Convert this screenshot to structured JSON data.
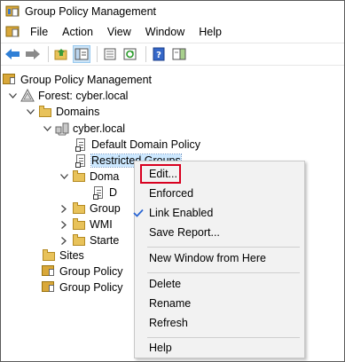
{
  "window": {
    "title": "Group Policy Management"
  },
  "menu": {
    "items": [
      "File",
      "Action",
      "View",
      "Window",
      "Help"
    ]
  },
  "toolbar": {
    "buttons": [
      "back-icon",
      "forward-icon",
      "up-folder-icon",
      "show-hide-tree-icon",
      "properties-icon",
      "refresh-icon",
      "help-icon",
      "action-pane-icon"
    ]
  },
  "tree": {
    "root": "Group Policy Management",
    "forest": "Forest: cyber.local",
    "domains": "Domains",
    "domain": "cyber.local",
    "default_policy": "Default Domain Policy",
    "restricted_groups": "Restricted Groups",
    "domain_controllers_partial": "Doma",
    "dc_child_partial": "D",
    "gpo_partial": "Group",
    "wmi_partial": "WMI",
    "starter_partial": "Starte",
    "sites": "Sites",
    "gp_modeling_partial": "Group Policy",
    "gp_results_partial": "Group Policy"
  },
  "context_menu": {
    "edit": "Edit...",
    "enforced": "Enforced",
    "link_enabled": "Link Enabled",
    "save_report": "Save Report...",
    "new_window": "New Window from Here",
    "delete": "Delete",
    "rename": "Rename",
    "refresh": "Refresh",
    "help": "Help",
    "link_enabled_checked": true
  },
  "colors": {
    "selection": "#cce8ff",
    "highlight_box": "#d8001f",
    "check": "#2a66d4",
    "toolbar_active": "#cce4f7"
  }
}
